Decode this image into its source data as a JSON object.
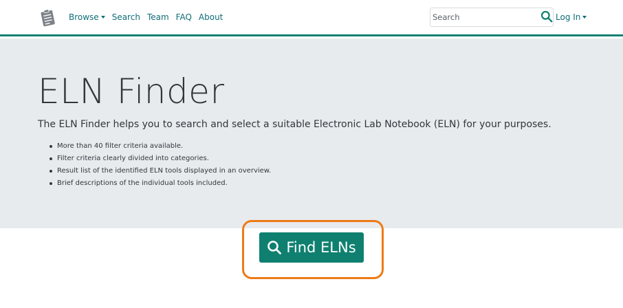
{
  "colors": {
    "accent": "#0f8070",
    "link": "#0f6e78",
    "highlight": "#ee7a16",
    "hero_bg": "#e8ebee"
  },
  "navbar": {
    "logo_icon": "clipboard-notes-icon",
    "links": [
      {
        "label": "Browse",
        "dropdown": true
      },
      {
        "label": "Search"
      },
      {
        "label": "Team"
      },
      {
        "label": "FAQ"
      },
      {
        "label": "About"
      }
    ],
    "search": {
      "placeholder": "Search",
      "value": "",
      "icon": "search-icon"
    },
    "login_label": "Log In"
  },
  "hero": {
    "title": "ELN Finder",
    "lead": "The ELN Finder helps you to search and select a suitable Electronic Lab Notebook (ELN) for your purposes.",
    "features": [
      "More than 40 filter criteria available.",
      "Filter criteria clearly divided into categories.",
      "Result list of the identified ELN tools displayed in an overview.",
      "Brief descriptions of the individual tools included."
    ]
  },
  "cta": {
    "label": "Find ELNs",
    "icon": "search-icon"
  }
}
